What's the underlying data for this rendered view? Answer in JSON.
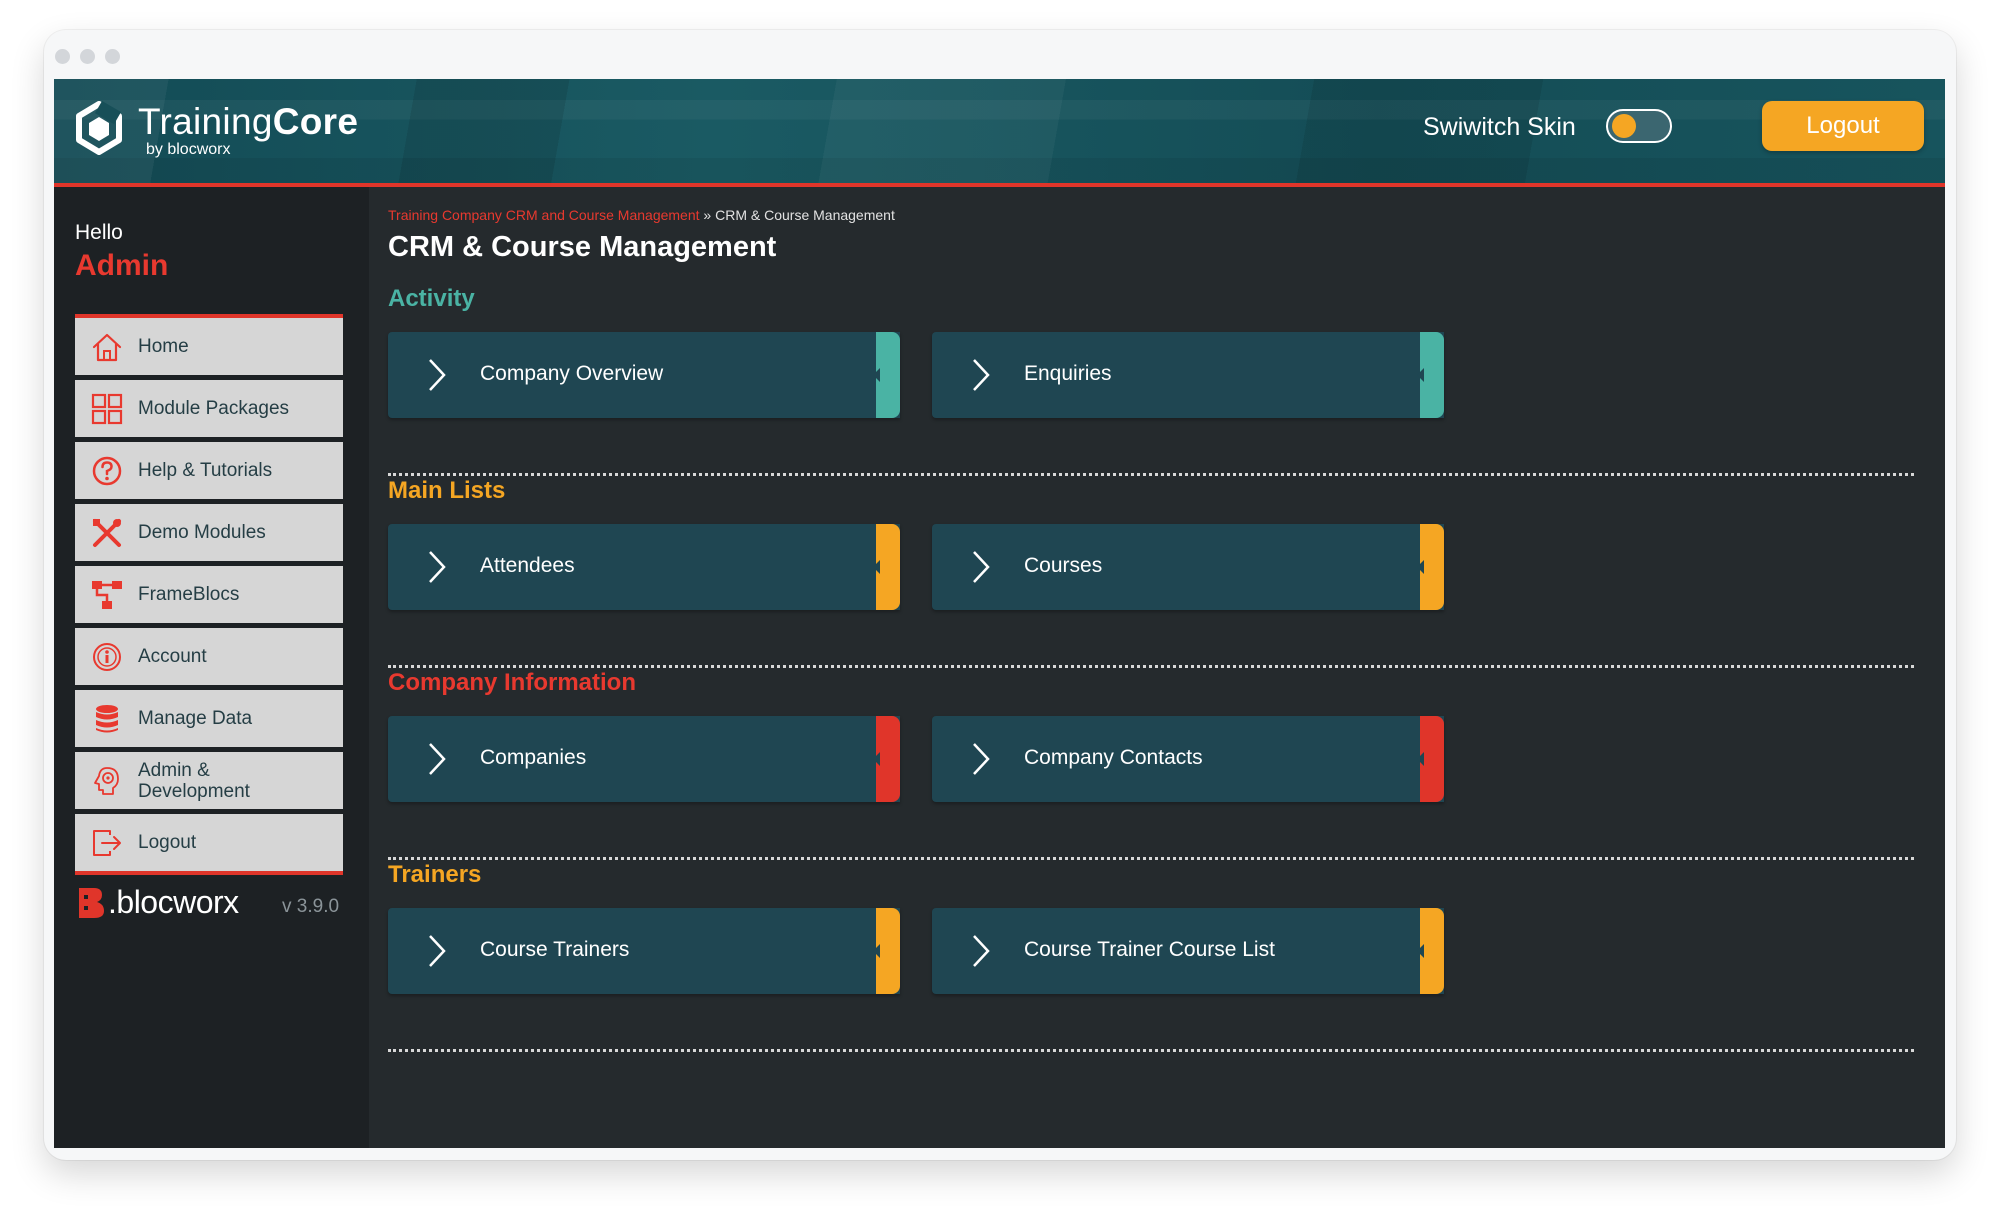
{
  "header": {
    "brand_name_light": "Training",
    "brand_name_bold": "Core",
    "brand_sub": "by blocworx",
    "skin_label": "Swiwitch Skin",
    "logout_label": "Logout"
  },
  "sidebar": {
    "greeting": "Hello",
    "user": "Admin",
    "items": [
      {
        "label": "Home",
        "icon": "home-icon"
      },
      {
        "label": "Module Packages",
        "icon": "module-packages-icon"
      },
      {
        "label": "Help & Tutorials",
        "icon": "help-icon"
      },
      {
        "label": "Demo Modules",
        "icon": "demo-modules-icon"
      },
      {
        "label": "FrameBlocs",
        "icon": "frameblocs-icon"
      },
      {
        "label": "Account",
        "icon": "account-icon"
      },
      {
        "label": "Manage Data",
        "icon": "database-icon"
      },
      {
        "label": "Admin & Development",
        "icon": "admin-gear-icon"
      },
      {
        "label": "Logout",
        "icon": "logout-icon"
      }
    ],
    "footer_logo": ".blocworx",
    "version": "v 3.9.0"
  },
  "breadcrumb": {
    "link": "Training Company CRM and Course Management",
    "separator": " » ",
    "current": "CRM & Course Management"
  },
  "page_title": "CRM & Course Management",
  "sections": [
    {
      "title": "Activity",
      "color": "#4ab3a4",
      "cards": [
        "Company Overview",
        "Enquiries"
      ]
    },
    {
      "title": "Main Lists",
      "color": "#f5a623",
      "cards": [
        "Attendees",
        "Courses"
      ]
    },
    {
      "title": "Company Information",
      "color": "#e8392f",
      "cards": [
        "Companies",
        "Company Contacts"
      ]
    },
    {
      "title": "Trainers",
      "color": "#f5a623",
      "cards": [
        "Course Trainers",
        "Course Trainer Course List"
      ]
    }
  ],
  "colors": {
    "accent_red": "#e0352a",
    "accent_orange": "#f5a623",
    "accent_teal": "#4ab3a4",
    "card_bg": "#1f4652"
  }
}
